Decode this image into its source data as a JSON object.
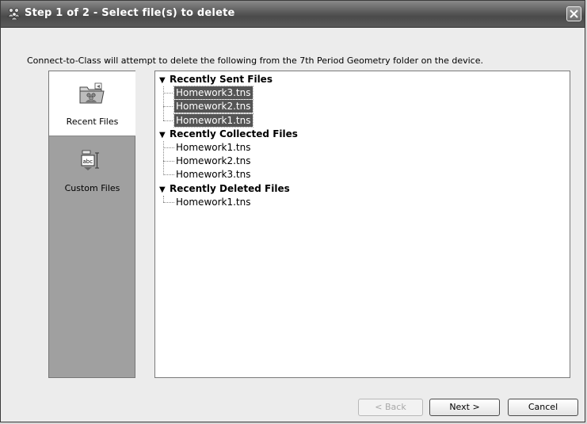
{
  "window": {
    "title": "Step 1 of 2 - Select file(s) to delete",
    "title_icon": "users-group-icon",
    "close_icon": "close-icon"
  },
  "instruction": "Connect-to-Class will attempt to delete the following from the 7th Period Geometry folder on the device.",
  "sidebar": {
    "items": [
      {
        "label": "Recent Files",
        "icon": "folder-users-icon",
        "selected": true
      },
      {
        "label": "Custom Files",
        "icon": "abc-document-icon",
        "selected": false
      }
    ]
  },
  "tree": {
    "groups": [
      {
        "title": "Recently Sent Files",
        "expanded": true,
        "items": [
          {
            "name": "Homework3.tns",
            "selected": true
          },
          {
            "name": "Homework2.tns",
            "selected": true
          },
          {
            "name": "Homework1.tns",
            "selected": true
          }
        ]
      },
      {
        "title": "Recently Collected Files",
        "expanded": true,
        "items": [
          {
            "name": "Homework1.tns",
            "selected": false
          },
          {
            "name": "Homework2.tns",
            "selected": false
          },
          {
            "name": "Homework3.tns",
            "selected": false
          }
        ]
      },
      {
        "title": "Recently Deleted Files",
        "expanded": true,
        "items": [
          {
            "name": "Homework1.tns",
            "selected": false
          }
        ]
      }
    ],
    "expand_glyph": "▼"
  },
  "buttons": {
    "back": {
      "label": "< Back",
      "enabled": false
    },
    "next": {
      "label": "Next >",
      "enabled": true
    },
    "cancel": {
      "label": "Cancel",
      "enabled": true
    }
  },
  "colors": {
    "selection": "#555555",
    "sidebar": "#a0a0a0",
    "titlebar": "#4a4a4a"
  }
}
